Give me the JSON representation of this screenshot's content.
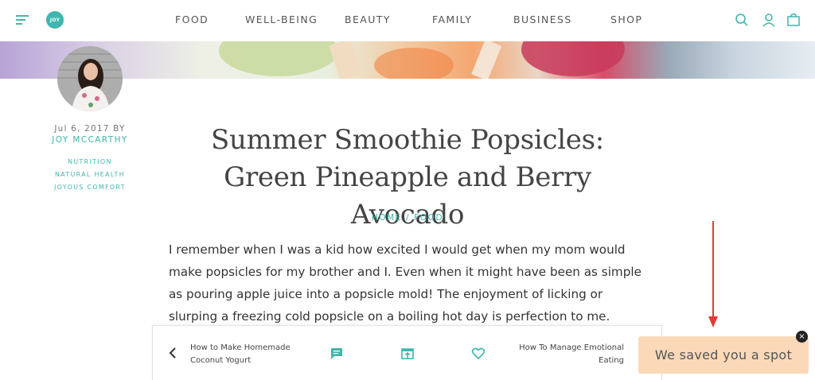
{
  "header": {
    "logo_text": "JOY",
    "nav": [
      "FOOD",
      "WELL-BEING",
      "BEAUTY",
      "FAMILY",
      "BUSINESS",
      "SHOP"
    ],
    "accent_color": "#3fb6ad"
  },
  "article": {
    "date": "Jul 6, 2017 BY",
    "author": "JOY MCCARTHY",
    "tags": [
      "NUTRITION",
      "NATURAL HEALTH",
      "JOYOUS COMFORT"
    ],
    "title": "Summer Smoothie Popsicles: Green Pineapple and Berry Avocado",
    "breadcrumb": {
      "home": "HOME",
      "separator": "/",
      "section": "FOOD"
    },
    "body": "I remember when I was a kid how excited I would get when my mom would make popsicles for my brother and I. Even when it might have been as simple as pouring apple juice into a popsicle mold! The enjoyment of licking or slurping a freezing cold popsicle on a boiling hot day is perfection to me."
  },
  "bottom_nav": {
    "prev_title": "How to Make Homemade Coconut Yogurt",
    "next_title": "How To Manage Emotional Eating",
    "icons": [
      "comment-icon",
      "share-icon",
      "heart-icon"
    ]
  },
  "toast": {
    "text": "We saved you a spot",
    "close_symbol": "×",
    "background": "#fbd9b8"
  },
  "annotation_color": "#e53935"
}
